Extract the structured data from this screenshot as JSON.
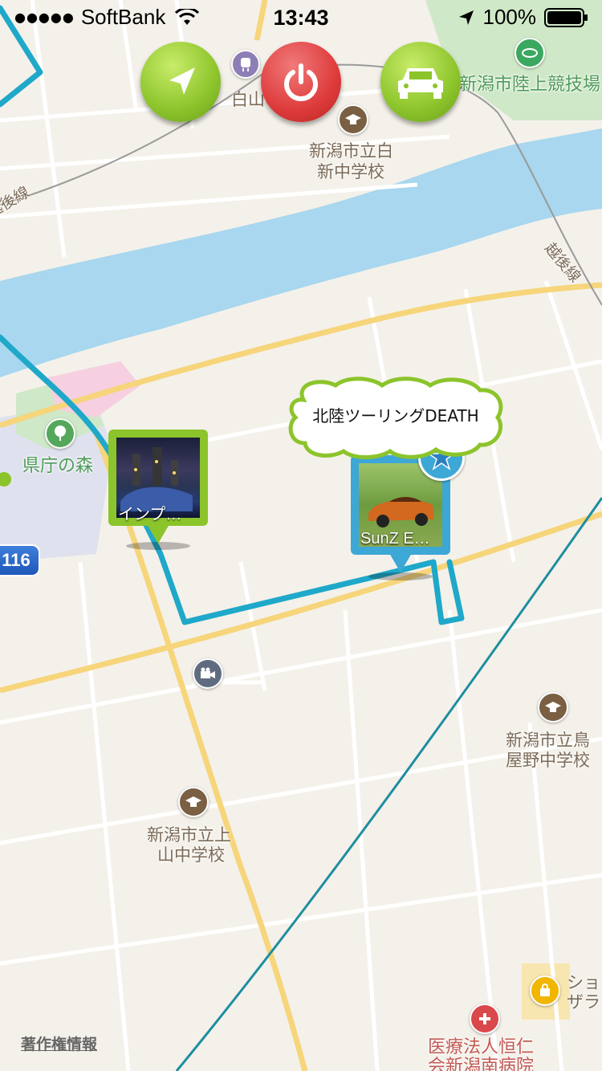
{
  "status_bar": {
    "signal_dots": "●●●●●",
    "carrier": "SoftBank",
    "time": "13:43",
    "battery_percent": "100%"
  },
  "controls": {
    "location_icon": "location-arrow-icon",
    "power_icon": "power-icon",
    "car_icon": "car-icon"
  },
  "map_labels": {
    "station": "白山",
    "stadium": "新潟市陸上競技場",
    "school_hakushin_1": "新潟市立白",
    "school_hakushin_2": "新中学校",
    "rail_echigo_1": "越後線",
    "rail_echigo_2": "越後線",
    "park": "県庁の森",
    "route_number": "116",
    "school_toriyano_1": "新潟市立鳥",
    "school_toriyano_2": "屋野中学校",
    "school_kamiyama_1": "新潟市立上",
    "school_kamiyama_2": "山中学校",
    "hospital_1": "医療法人恒仁",
    "hospital_2": "会新潟南病院",
    "shop_1": "ショ",
    "shop_2": "ザラ"
  },
  "pins": [
    {
      "caption": "インプ…",
      "color": "#8cc42b"
    },
    {
      "caption": "SunZ E…",
      "color": "#3da7d6"
    }
  ],
  "bubble": {
    "text": "北陸ツーリングDEATH"
  },
  "colors": {
    "route": "#1fa8c9",
    "river": "#a8d7ef",
    "road_major": "#f6d57b",
    "park": "#cfe8c7"
  },
  "footer": {
    "copyright": "著作権情報"
  }
}
